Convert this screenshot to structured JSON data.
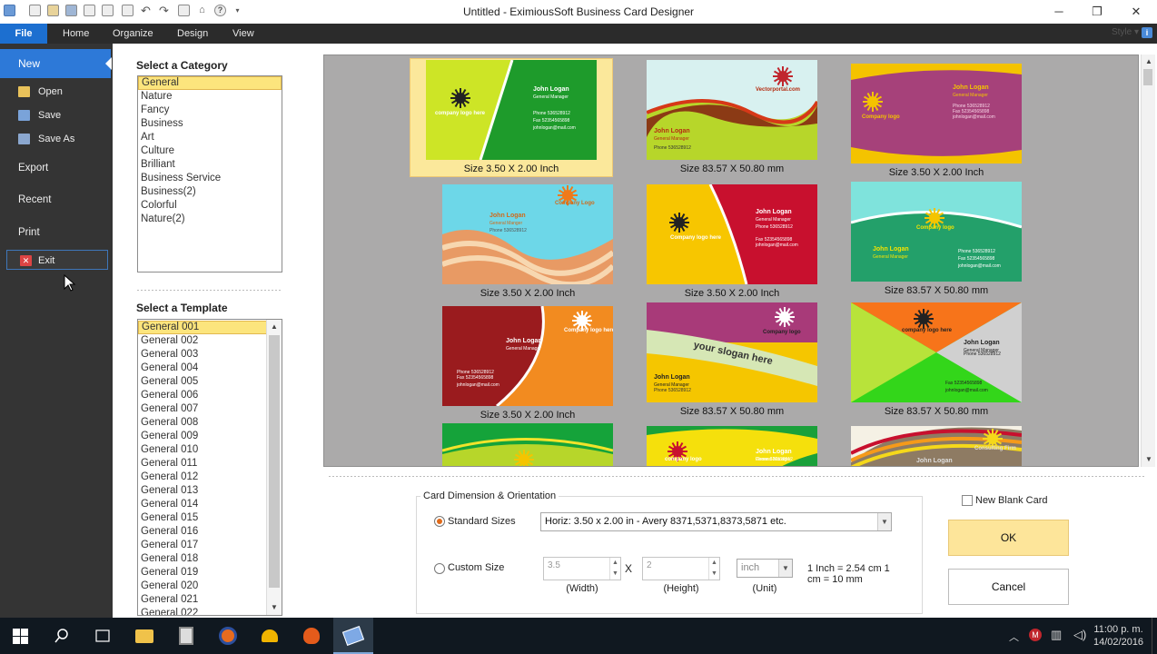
{
  "window": {
    "title": "Untitled - EximiousSoft Business Card Designer",
    "minimize": "─",
    "restore": "❐",
    "close": "✕"
  },
  "ribbon": {
    "tabs": [
      "File",
      "Home",
      "Organize",
      "Design",
      "View"
    ],
    "style_label": "Style"
  },
  "file_menu": {
    "new": "New",
    "open": "Open",
    "save": "Save",
    "save_as": "Save As",
    "export": "Export",
    "recent": "Recent",
    "print": "Print",
    "exit": "Exit"
  },
  "category": {
    "header": "Select a Category",
    "items": [
      "General",
      "Nature",
      "Fancy",
      "Business",
      "Art",
      "Culture",
      "Brilliant",
      "Business Service",
      "Business(2)",
      "Colorful",
      "Nature(2)"
    ],
    "selected": "General"
  },
  "template": {
    "header": "Select a Template",
    "items": [
      "General 001",
      "General 002",
      "General 003",
      "General 004",
      "General 005",
      "General 006",
      "General 007",
      "General 008",
      "General 009",
      "General 010",
      "General 011",
      "General 012",
      "General 013",
      "General 014",
      "General 015",
      "General 016",
      "General 017",
      "General 018",
      "General 019",
      "General 020",
      "General 021",
      "General 022"
    ],
    "selected": "General 001"
  },
  "cards": [
    {
      "size": "Size 3.50 X 2.00 Inch",
      "style": "green-diagonal",
      "name": "John Logan",
      "title": "General Manager",
      "logo_text": "company logo here",
      "selected": true
    },
    {
      "size": "Size 83.57 X 50.80 mm",
      "style": "wave-brown",
      "name": "John Logan",
      "title": "General Manager",
      "logo_text": "Vectorportal.com"
    },
    {
      "size": "Size 3.50 X 2.00 Inch",
      "style": "purple-yellow",
      "name": "John Logan",
      "title": "General Manager",
      "logo_text": "Company logo"
    },
    {
      "size": "Size 3.50 X 2.00 Inch",
      "style": "orange-stripes",
      "name": "John Logan",
      "title": "General Manger",
      "logo_text": "Company Logo"
    },
    {
      "size": "Size 3.50 X 2.00 Inch",
      "style": "red-yellow",
      "name": "John Logan",
      "title": "General Manager",
      "logo_text": "Company logo here"
    },
    {
      "size": "Size 83.57 X 50.80 mm",
      "style": "teal-green",
      "name": "John Logan",
      "title": "General Manager",
      "logo_text": "Company logo"
    },
    {
      "size": "Size 3.50 X 2.00 Inch",
      "style": "darkred-orange",
      "name": "John Logan",
      "title": "General Manager",
      "logo_text": "Company logo here"
    },
    {
      "size": "Size 83.57 X 50.80 mm",
      "style": "slogan",
      "name": "John Logan",
      "title": "General Manager",
      "logo_text": "Company logo",
      "slogan": "your slogan here"
    },
    {
      "size": "Size 83.57 X 50.80 mm",
      "style": "x-pattern",
      "name": "John Logan",
      "title": "General Manager",
      "logo_text": "company logo here"
    },
    {
      "size": "",
      "style": "green-wave",
      "name": "",
      "title": "",
      "logo_text": ""
    },
    {
      "size": "",
      "style": "green-yellow",
      "name": "John Logan",
      "title": "General Manager",
      "logo_text": "company logo"
    },
    {
      "size": "",
      "style": "retro-waves",
      "name": "John Logan",
      "title": "",
      "logo_text": "Consulting Firm"
    }
  ],
  "card_detail": {
    "phone": "Phone 536528912",
    "fax": "Fax 52354565898",
    "email": "johnlogan@mail.com",
    "web": "Web www.company.com",
    "phone_fax_line": "Phone 05283589  Fax 05245787"
  },
  "dimension": {
    "group_label": "Card Dimension & Orientation",
    "standard_label": "Standard Sizes",
    "standard_value": "Horiz: 3.50 x 2.00 in - Avery 8371,5371,8373,5871 etc.",
    "custom_label": "Custom Size",
    "width_value": "3.5",
    "height_value": "2",
    "x_symbol": "X",
    "width_caption": "(Width)",
    "height_caption": "(Height)",
    "unit_value": "inch",
    "unit_caption": "(Unit)",
    "conversion_line1": "1 Inch = 2.54 cm  1",
    "conversion_line2": "cm = 10 mm",
    "selected_option": "standard"
  },
  "actions": {
    "new_blank_label": "New Blank Card",
    "ok_label": "OK",
    "cancel_label": "Cancel"
  },
  "taskbar": {
    "time": "11:00 p. m.",
    "date": "14/02/2016"
  }
}
